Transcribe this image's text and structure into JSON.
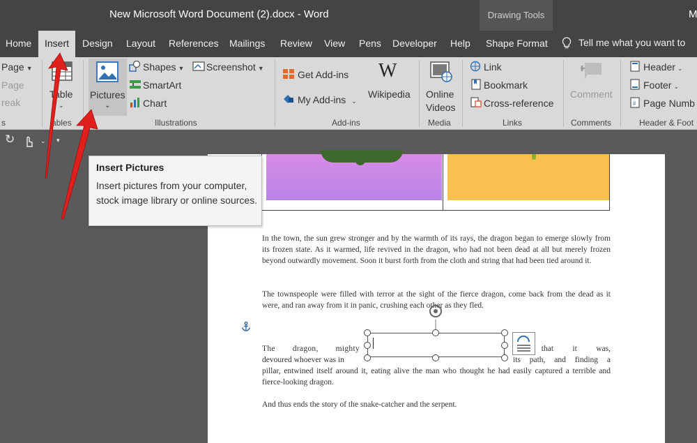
{
  "titlebar": {
    "title": "New Microsoft Word Document (2).docx  -  Word",
    "contextual_tab_group": "Drawing Tools",
    "user_initial": "M"
  },
  "tabs": [
    {
      "label": "Home"
    },
    {
      "label": "Insert",
      "active": true
    },
    {
      "label": "Design"
    },
    {
      "label": "Layout"
    },
    {
      "label": "References"
    },
    {
      "label": "Mailings"
    },
    {
      "label": "Review"
    },
    {
      "label": "View"
    },
    {
      "label": "Pens"
    },
    {
      "label": "Developer"
    },
    {
      "label": "Help"
    },
    {
      "label": "Shape Format"
    }
  ],
  "tell_me": "Tell me what you want to",
  "ribbon": {
    "pages": {
      "page": "Page",
      "page_dim": "Page",
      "break_dim": "reak",
      "group_label": "s"
    },
    "tables": {
      "label": "Table",
      "group_label": "ables"
    },
    "illustrations": {
      "pictures": "Pictures",
      "shapes": "Shapes",
      "smartart": "SmartArt",
      "chart": "Chart",
      "screenshot": "Screenshot",
      "group_label": "Illustrations"
    },
    "addins": {
      "get_addins": "Get Add-ins",
      "my_addins": "My Add-ins",
      "wikipedia": "Wikipedia",
      "group_label": "Add-ins"
    },
    "media": {
      "online_videos_1": "Online",
      "online_videos_2": "Videos",
      "group_label": "Media"
    },
    "links": {
      "link": "Link",
      "bookmark": "Bookmark",
      "cross_reference": "Cross-reference",
      "group_label": "Links"
    },
    "comments": {
      "comment": "Comment",
      "group_label": "Comments"
    },
    "header_footer": {
      "header": "Header",
      "footer": "Footer",
      "page_number": "Page Numb",
      "group_label": "Header & Foot"
    }
  },
  "tooltip": {
    "title": "Insert Pictures",
    "body": "Insert pictures from your computer, stock image library or online sources."
  },
  "document": {
    "para1": "In the town, the sun grew stronger and by the warmth of its rays, the dragon began to emerge slowly from its frozen state. As it warmed, life revived in the dragon, who had not been dead at all but merely frozen beyond outwardly movement. Soon it burst forth from the cloth and string that had been tied around it.",
    "para2": "The townspeople were filled with terror at the sight of the fierce dragon, come back from the dead as it were, and ran away from it in panic, crushing each other as they fled.",
    "para3_left": "The dragon, mighty",
    "para3_right": "it that it was,",
    "para3_l2_left": "devoured whoever was in",
    "para3_l2_right": "its path, and finding a",
    "para3_rest": "pillar, entwined itself around it, eating alive the man who thought he had easily captured a terrible and fierce-looking dragon.",
    "para4": "And thus ends the story of the snake-catcher and the serpent."
  },
  "colors": {
    "titlebar": "#444444",
    "ribbon": "#d9d9d9",
    "workspace": "#5a5a5a",
    "annotation_arrow": "#e0201c"
  }
}
